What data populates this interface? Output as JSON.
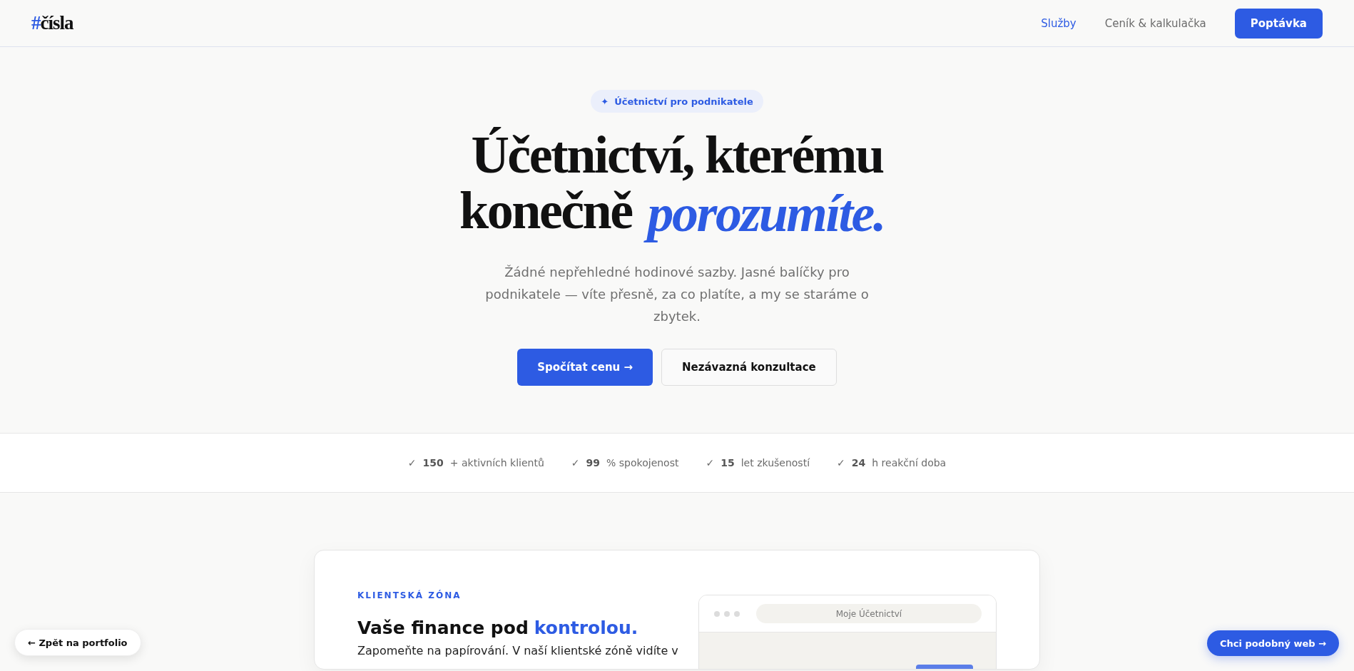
{
  "header": {
    "logo": {
      "mark": "#",
      "word": "čísla"
    },
    "nav": [
      {
        "label": "Služby",
        "selected": true
      },
      {
        "label": "Ceník & kalkulačka",
        "selected": false
      }
    ],
    "cta": "Poptávka"
  },
  "hero": {
    "badge": {
      "icon": "✦",
      "label": "Účetnictví pro podnikatele"
    },
    "title": {
      "line_1": "Účetnictví, kterému",
      "line_2_lead": "konečně",
      "line_2_accent": "porozumíte."
    },
    "subtitle": "Žádné nepřehledné hodinové sazby. Jasné balíčky pro podnikatele — víte přesně, za co platíte, a my se staráme o zbytek.",
    "buttons": [
      {
        "label": "Spočítat cenu →",
        "kind": "primary"
      },
      {
        "label": "Nezávazná konzultace",
        "kind": "secondary"
      }
    ]
  },
  "stats": [
    {
      "check": "✓",
      "value": "150",
      "label": "+ aktivních klientů"
    },
    {
      "check": "✓",
      "value": "99",
      "label": "% spokojenost"
    },
    {
      "check": "✓",
      "value": "15",
      "label": "let zkušeností"
    },
    {
      "check": "✓",
      "value": "24",
      "label": "h reakční doba"
    }
  ],
  "client_zone": {
    "eyebrow": "KLIENTSKÁ ZÓNA",
    "heading_lead": "Vaše finance pod",
    "heading_accent": "kontrolou.",
    "text": "Zapomeňte na papírování. V naší klientské zóně vidíte v",
    "browser": {
      "title": "Moje Účetnictví"
    }
  },
  "floating": {
    "back": "← Zpět na portfolio",
    "similar": "Chci podobný web →"
  }
}
